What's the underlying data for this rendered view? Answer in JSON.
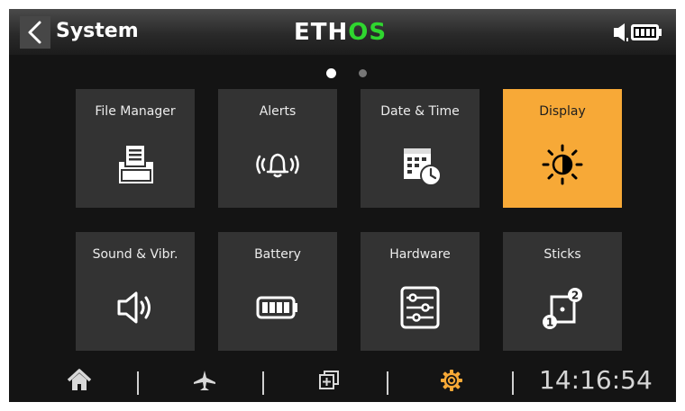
{
  "header": {
    "back_icon": "chevron-left-icon",
    "title": "System",
    "logo_prefix": "ETH",
    "logo_suffix": "OS",
    "logo_color": "#2fd62f",
    "status_icons": [
      "speaker-icon",
      "battery-icon"
    ]
  },
  "pager": {
    "pages": 2,
    "current_page": 1
  },
  "tiles": [
    {
      "label": "File Manager",
      "icon": "file-manager-icon",
      "selected": false
    },
    {
      "label": "Alerts",
      "icon": "bell-ringing-icon",
      "selected": false
    },
    {
      "label": "Date & Time",
      "icon": "calendar-clock-icon",
      "selected": false
    },
    {
      "label": "Display",
      "icon": "brightness-icon",
      "selected": true
    },
    {
      "label": "Sound & Vibr.",
      "icon": "speaker-icon",
      "selected": false
    },
    {
      "label": "Battery",
      "icon": "battery-icon",
      "selected": false
    },
    {
      "label": "Hardware",
      "icon": "sliders-icon",
      "selected": false
    },
    {
      "label": "Sticks",
      "icon": "sticks-icon",
      "selected": false
    }
  ],
  "footer": {
    "nav": [
      {
        "icon": "home-icon",
        "active": false
      },
      {
        "icon": "airplane-icon",
        "active": false
      },
      {
        "icon": "widgets-icon",
        "active": false
      },
      {
        "icon": "gear-icon",
        "active": true
      }
    ],
    "clock": "14:16:54"
  },
  "colors": {
    "accent": "#f7a937",
    "tile_bg": "#333333",
    "screen_bg": "#141414"
  }
}
